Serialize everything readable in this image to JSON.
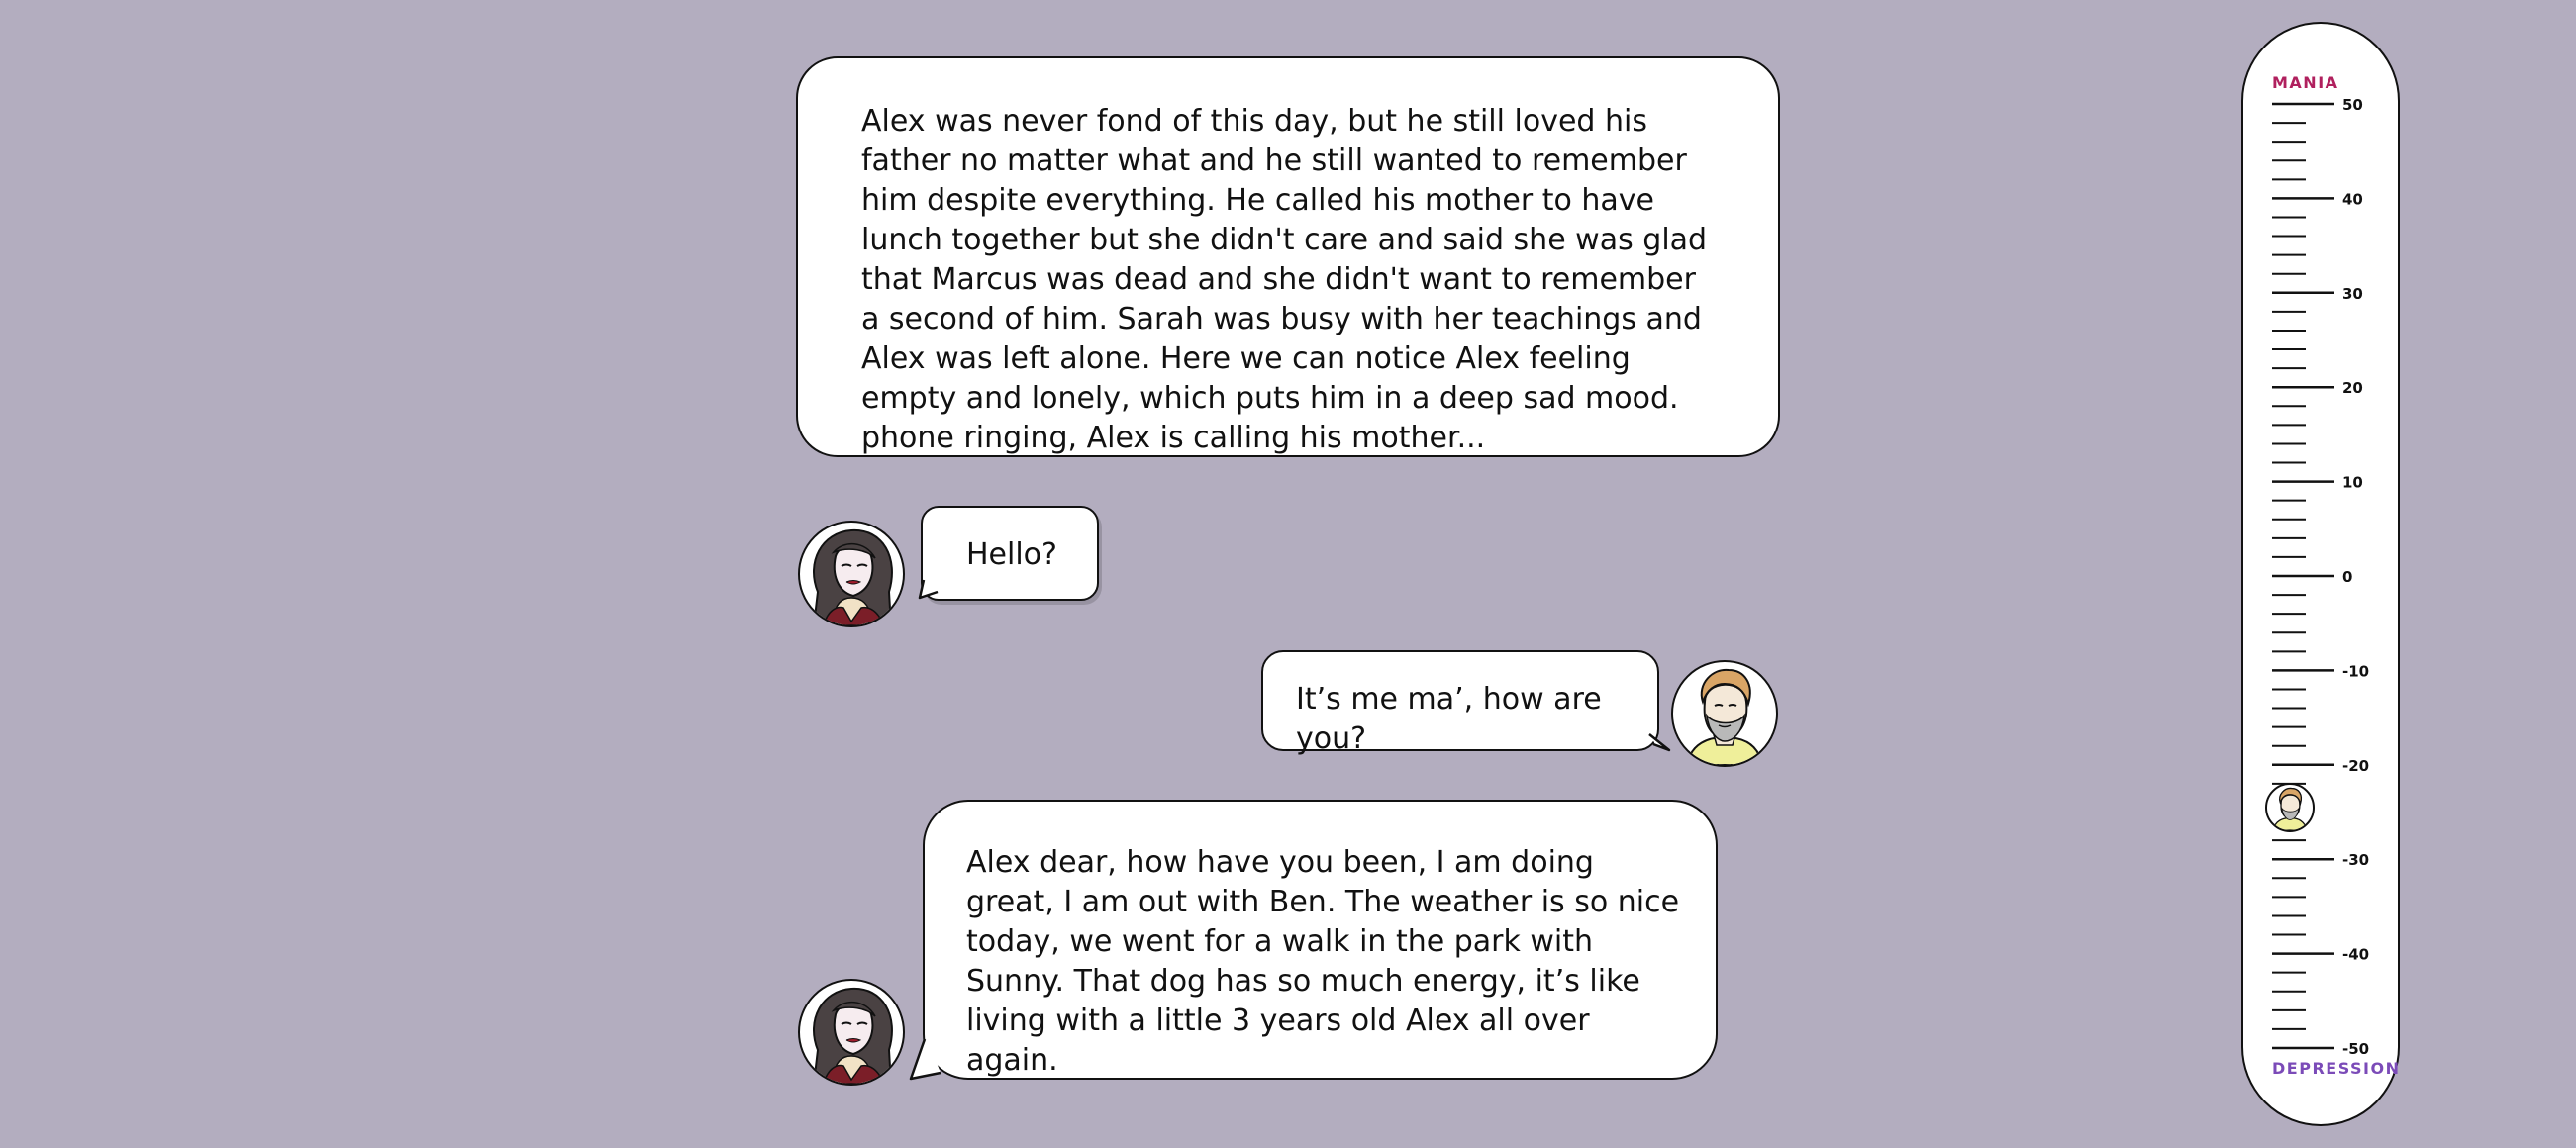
{
  "narration": "Alex was never fond of this day, but he still loved his father no matter what and he still wanted to remember him despite everything. He called his mother to have lunch together but she didn't care and said she was glad that Marcus was dead and she didn't want to remember a second of him. Sarah was busy with her teachings and Alex was left alone. Here we can notice Alex feeling empty and lonely, which puts him in a deep sad mood. phone ringing, Alex is calling his mother...",
  "messages": [
    {
      "speaker": "mother",
      "text": "Hello?"
    },
    {
      "speaker": "alex",
      "text": "It’s me ma’, how are you?"
    },
    {
      "speaker": "mother",
      "text": "Alex dear, how have you been, I am doing great, I am out with Ben. The weather is so nice today, we went for a walk in the park with Sunny. That dog has so much energy, it’s like living with a little 3 years old Alex all over again."
    }
  ],
  "avatars": {
    "mother": "woman-portrait-icon",
    "alex": "bearded-man-portrait-icon"
  },
  "mood_meter": {
    "top_label": "MANIA",
    "bottom_label": "DEPRESSION",
    "top_label_color": "#b0205e",
    "bottom_label_color": "#7b4bb8",
    "ticks": [
      "50",
      "40",
      "30",
      "20",
      "10",
      "0",
      "-10",
      "-20",
      "-30",
      "-40",
      "-50"
    ],
    "current_value": -25,
    "marker_icon": "bearded-man-portrait-icon"
  },
  "colors": {
    "background": "#b3adbf",
    "bubble": "#ffffff"
  }
}
